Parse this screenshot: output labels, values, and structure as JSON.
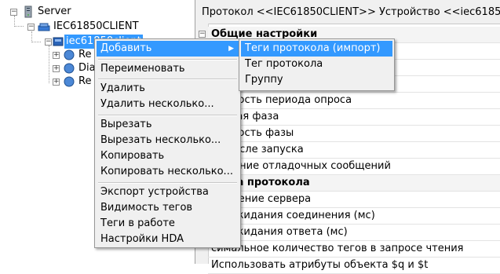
{
  "tree": {
    "root": "Server",
    "client": "IEC61850CLIENT",
    "device": "iec61850client",
    "children": [
      "Re",
      "Dia",
      "Re"
    ]
  },
  "right": {
    "header": "Протокол <<IEC61850CLIENT>> Устройство <<iec61850",
    "rows": [
      {
        "label": "Общие настройки",
        "group": true
      },
      {
        "label": "",
        "group": false
      },
      {
        "label": "",
        "group": false
      },
      {
        "label": "",
        "group": false
      },
      {
        "label": "мерность периода опроса",
        "group": false
      },
      {
        "label": "альная фаза",
        "group": false
      },
      {
        "label": "мерность фазы",
        "group": false
      },
      {
        "label": "от после запуска",
        "group": false
      },
      {
        "label": "решение отладочных сообщений",
        "group": false
      },
      {
        "label": "йства протокола",
        "group": true
      },
      {
        "label": "ключение сервера",
        "group": false
      },
      {
        "label": "мя ожидания соединения (мс)",
        "group": false
      },
      {
        "label": "мя ожидания ответа (мс)",
        "group": false
      },
      {
        "label": "симальное количество тегов в запросе чтения",
        "group": false
      },
      {
        "label": "Использовать атрибуты объекта $q и $t",
        "group": false
      }
    ]
  },
  "context_menu": {
    "items": [
      {
        "label": "Добавить",
        "submenu": true
      },
      {
        "label": "Переименовать"
      },
      {
        "label": "Удалить"
      },
      {
        "label": "Удалить несколько..."
      },
      {
        "label": "Вырезать"
      },
      {
        "label": "Вырезать несколько..."
      },
      {
        "label": "Копировать"
      },
      {
        "label": "Копировать несколько..."
      },
      {
        "label": "Экспорт устройства"
      },
      {
        "label": "Видимость тегов"
      },
      {
        "label": "Теги в работе"
      },
      {
        "label": "Настройки HDA"
      }
    ]
  },
  "submenu": {
    "items": [
      {
        "label": "Теги протокола (импорт)"
      },
      {
        "label": "Тег протокола"
      },
      {
        "label": "Группу"
      }
    ]
  },
  "colors": {
    "highlight": "#3399ff",
    "menu_bg": "#f0f0f0"
  }
}
